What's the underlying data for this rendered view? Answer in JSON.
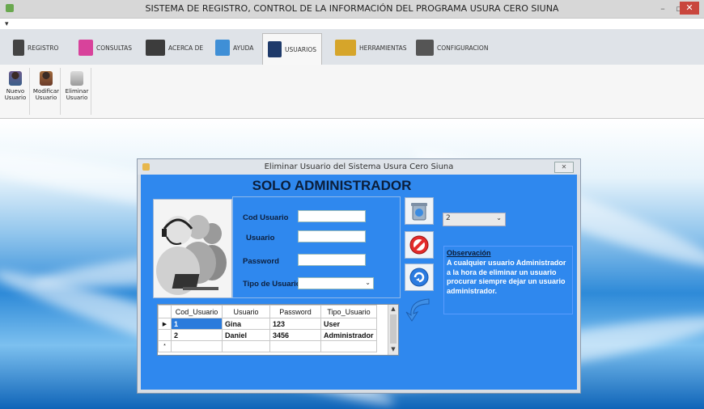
{
  "window": {
    "title": "SISTEMA DE REGISTRO, CONTROL DE LA INFORMACIÓN DEL PROGRAMA USURA CERO SIUNA",
    "minimize": "–",
    "restore": "▫",
    "close": "✕"
  },
  "qat": "▾",
  "tabs": [
    {
      "label": "REGISTRO",
      "icon": "registry-icon",
      "color": "#444444"
    },
    {
      "label": "CONSULTAS",
      "icon": "consult-icon",
      "color": "#d8429b"
    },
    {
      "label": "ACERCA DE",
      "icon": "computer-icon",
      "color": "#3c3c3c"
    },
    {
      "label": "AYUDA",
      "icon": "help-icon",
      "color": "#3f8fd6"
    },
    {
      "label": "USUARIOS",
      "icon": "users-icon",
      "color": "#1e3a6a",
      "active": true
    },
    {
      "label": "HERRAMIENTAS",
      "icon": "tools-icon",
      "color": "#d6a52a"
    },
    {
      "label": "CONFIGURACION",
      "icon": "settings-icon",
      "color": "#555555"
    }
  ],
  "ribbon": {
    "buttons": [
      {
        "label1": "Nuevo",
        "label2": "Usuario"
      },
      {
        "label1": "Modificar",
        "label2": "Usuario"
      },
      {
        "label1": "Eliminar",
        "label2": "Usuario"
      }
    ]
  },
  "dialog": {
    "title": "Eliminar Usuario del Sistema Usura Cero Siuna",
    "close": "✕",
    "heading": "SOLO ADMINISTRADOR",
    "form": {
      "cod_label": "Cod Usuario",
      "user_label": "Usuario",
      "pass_label": "Password",
      "tipo_label": "Tipo de Usuario",
      "tipo_arrow": "⌄"
    },
    "grid": {
      "headers": [
        "Cod_Usuario",
        "Usuario",
        "Password",
        "Tipo_Usuario"
      ],
      "rows": [
        {
          "indicator": "▶",
          "cells": [
            "1",
            "Gina",
            "123",
            "User"
          ]
        },
        {
          "indicator": "",
          "cells": [
            "2",
            "Daniel",
            "3456",
            "Administrador"
          ]
        },
        {
          "indicator": "*",
          "cells": [
            "",
            "",
            "",
            ""
          ]
        }
      ]
    },
    "combo": {
      "value": "2",
      "arrow": "⌄"
    },
    "observation": {
      "title": "Observación",
      "text": "A cualquier usuario Administrador a la hora de eliminar un usuario procurar siempre dejar un usuario administrador."
    }
  }
}
